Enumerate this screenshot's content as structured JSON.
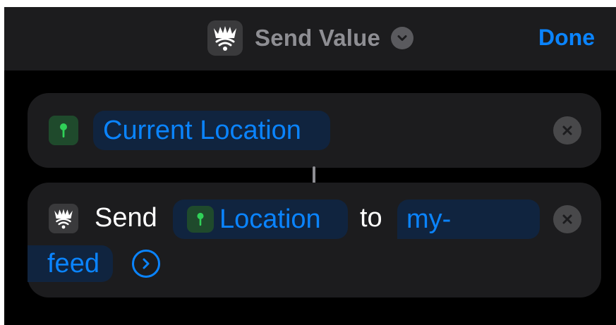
{
  "header": {
    "title": "Send Value",
    "done_label": "Done",
    "app_icon": "adafruit-star-icon",
    "chevron_icon": "chevron-down-icon"
  },
  "actions": [
    {
      "icon": "location-pin-icon",
      "variable_label": "Current Location",
      "close_icon": "close-icon"
    },
    {
      "icon": "adafruit-star-icon",
      "verb": "Send",
      "parameter_icon": "location-pin-icon",
      "parameter_label": "Location",
      "connector_word": "to",
      "feed_line1": "my-",
      "feed_line2": "feed",
      "expand_icon": "chevron-right-circle-icon",
      "close_icon": "close-icon"
    }
  ],
  "colors": {
    "accent": "#0a84ff",
    "card": "#1c1c1e",
    "background": "#000000",
    "location_green": "#30d158"
  }
}
